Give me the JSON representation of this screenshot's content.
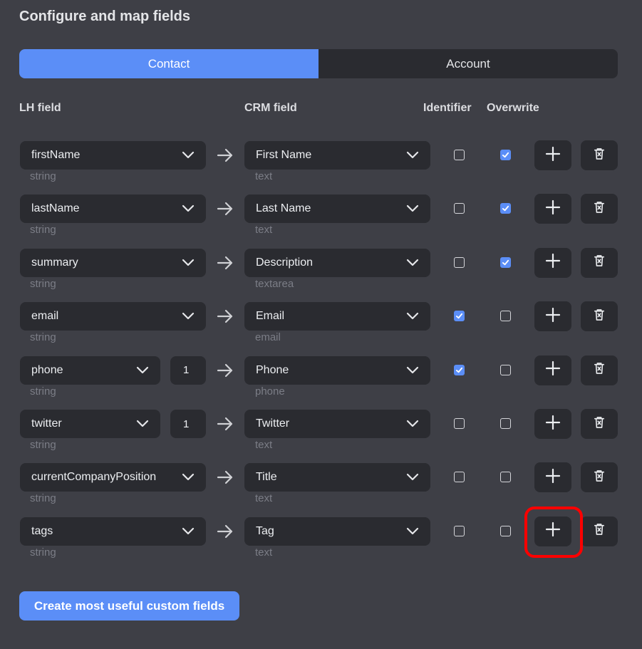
{
  "header": {
    "title": "Configure and map fields"
  },
  "tabs": [
    {
      "label": "Contact",
      "active": true
    },
    {
      "label": "Account",
      "active": false
    }
  ],
  "columns": {
    "lh_field": "LH field",
    "crm_field": "CRM field",
    "identifier": "Identifier",
    "overwrite": "Overwrite"
  },
  "rows": [
    {
      "lh": "firstName",
      "lh_type": "string",
      "index": null,
      "crm": "First Name",
      "crm_type": "text",
      "identifier": false,
      "overwrite": true
    },
    {
      "lh": "lastName",
      "lh_type": "string",
      "index": null,
      "crm": "Last Name",
      "crm_type": "text",
      "identifier": false,
      "overwrite": true
    },
    {
      "lh": "summary",
      "lh_type": "string",
      "index": null,
      "crm": "Description",
      "crm_type": "textarea",
      "identifier": false,
      "overwrite": true
    },
    {
      "lh": "email",
      "lh_type": "string",
      "index": null,
      "crm": "Email",
      "crm_type": "email",
      "identifier": true,
      "overwrite": false
    },
    {
      "lh": "phone",
      "lh_type": "string",
      "index": "1",
      "crm": "Phone",
      "crm_type": "phone",
      "identifier": true,
      "overwrite": false
    },
    {
      "lh": "twitter",
      "lh_type": "string",
      "index": "1",
      "crm": "Twitter",
      "crm_type": "text",
      "identifier": false,
      "overwrite": false
    },
    {
      "lh": "currentCompanyPosition",
      "lh_type": "string",
      "index": null,
      "crm": "Title",
      "crm_type": "text",
      "identifier": false,
      "overwrite": false
    },
    {
      "lh": "tags",
      "lh_type": "string",
      "index": null,
      "crm": "Tag",
      "crm_type": "text",
      "identifier": false,
      "overwrite": false
    }
  ],
  "actions": {
    "create_custom_fields": "Create most useful custom fields"
  },
  "icons": {
    "chevron": "chevron-down-icon",
    "arrow": "arrow-right-icon",
    "add": "plus-icon",
    "delete": "trash-icon",
    "check": "check-icon"
  },
  "colors": {
    "accent": "#5b8ef7",
    "background": "#3e3f46",
    "control": "#2a2b30",
    "highlight": "#ff0000"
  }
}
